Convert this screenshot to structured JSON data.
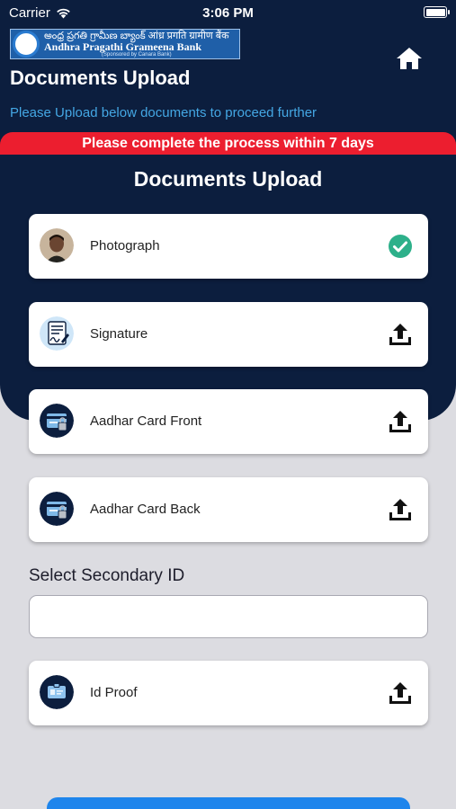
{
  "status_bar": {
    "carrier": "Carrier",
    "time": "3:06 PM"
  },
  "header": {
    "logo_line1": "అంధ్ర ప్రగతి గ్రామీణ బ్యాంక్ आंध्र प्रगति ग्रामीण बैंक",
    "logo_line2": "Andhra Pragathi Grameena Bank",
    "logo_line3": "(Sponsored by Canara Bank)",
    "title": "Documents Upload",
    "subtitle": "Please Upload below documents to proceed further"
  },
  "banner": {
    "text": "Please complete the process within 7 days"
  },
  "section_title": "Documents Upload",
  "documents": [
    {
      "label": "Photograph",
      "icon": "user-photo-icon",
      "status": "uploaded",
      "action_icon": "check-circle-icon"
    },
    {
      "label": "Signature",
      "icon": "signature-icon",
      "status": "pending",
      "action_icon": "upload-icon"
    },
    {
      "label": "Aadhar Card Front",
      "icon": "id-card-icon",
      "status": "pending",
      "action_icon": "upload-icon"
    },
    {
      "label": "Aadhar Card Back",
      "icon": "id-card-icon",
      "status": "pending",
      "action_icon": "upload-icon"
    }
  ],
  "secondary_id": {
    "label": "Select Secondary ID",
    "value": "",
    "placeholder": ""
  },
  "id_proof": {
    "label": "Id Proof",
    "icon": "id-badge-icon",
    "action_icon": "upload-icon"
  },
  "colors": {
    "header_bg": "#0c1e3e",
    "page_bg": "#dcdce1",
    "banner_bg": "#ec1e2f",
    "accent_blue": "#44a7e4",
    "check_green": "#2db08a",
    "button_blue": "#1e85ec"
  }
}
